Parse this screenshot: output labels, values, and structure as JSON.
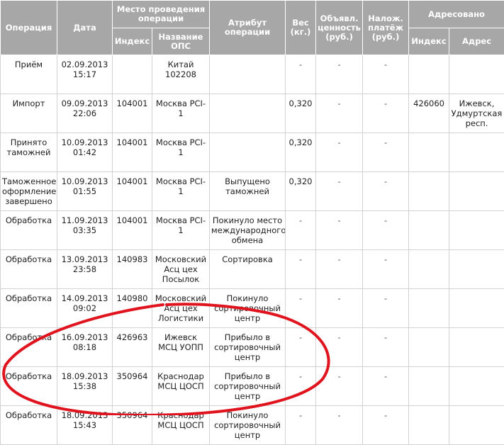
{
  "headers": {
    "operation": "Операция",
    "date": "Дата",
    "place": "Место проведения операции",
    "place_index": "Индекс",
    "place_name": "Название ОПС",
    "attribute": "Атрибут операции",
    "weight": "Вес (кг.)",
    "declared_value": "Объявл. ценность (руб.)",
    "cod": "Налож. платёж (руб.)",
    "addressed": "Адресовано",
    "addr_index": "Индекс",
    "addr_address": "Адрес"
  },
  "rows": [
    {
      "op": "Приём",
      "date": "02.09.2013",
      "time": "15:17",
      "index": "",
      "ops": "Китай 102208",
      "attr": "",
      "weight": "-",
      "value": "-",
      "cod": "-",
      "aidx": "",
      "addr": ""
    },
    {
      "op": "Импорт",
      "date": "09.09.2013",
      "time": "22:06",
      "index": "104001",
      "ops": "Москва PCI-1",
      "attr": "",
      "weight": "0,320",
      "value": "-",
      "cod": "-",
      "aidx": "426060",
      "addr": "Ижевск, Удмуртская респ."
    },
    {
      "op": "Принято таможней",
      "date": "10.09.2013",
      "time": "01:42",
      "index": "104001",
      "ops": "Москва PCI-1",
      "attr": "",
      "weight": "0,320",
      "value": "-",
      "cod": "-",
      "aidx": "",
      "addr": ""
    },
    {
      "op": "Таможенное оформление завершено",
      "date": "10.09.2013",
      "time": "01:55",
      "index": "104001",
      "ops": "Москва PCI-1",
      "attr": "Выпущено таможней",
      "weight": "0,320",
      "value": "-",
      "cod": "-",
      "aidx": "",
      "addr": ""
    },
    {
      "op": "Обработка",
      "date": "11.09.2013",
      "time": "03:35",
      "index": "104001",
      "ops": "Москва PCI-1",
      "attr": "Покинуло место международного обмена",
      "weight": "-",
      "value": "-",
      "cod": "-",
      "aidx": "",
      "addr": ""
    },
    {
      "op": "Обработка",
      "date": "13.09.2013",
      "time": "23:58",
      "index": "140983",
      "ops": "Московский Асц цех Посылок",
      "attr": "Сортировка",
      "weight": "-",
      "value": "-",
      "cod": "-",
      "aidx": "",
      "addr": ""
    },
    {
      "op": "Обработка",
      "date": "14.09.2013",
      "time": "09:02",
      "index": "140980",
      "ops": "Московский Асц цех Логистики",
      "attr": "Покинуло сортировочный центр",
      "weight": "-",
      "value": "-",
      "cod": "-",
      "aidx": "",
      "addr": ""
    },
    {
      "op": "Обработка",
      "date": "16.09.2013",
      "time": "08:18",
      "index": "426963",
      "ops": "Ижевск МСЦ УОПП",
      "attr": "Прибыло в сортировочный центр",
      "weight": "-",
      "value": "-",
      "cod": "-",
      "aidx": "",
      "addr": ""
    },
    {
      "op": "Обработка",
      "date": "18.09.2013",
      "time": "15:38",
      "index": "350964",
      "ops": "Краснодар МСЦ ЦОСП",
      "attr": "Прибыло в сортировочный центр",
      "weight": "-",
      "value": "-",
      "cod": "-",
      "aidx": "",
      "addr": ""
    },
    {
      "op": "Обработка",
      "date": "18.09.2013",
      "time": "15:43",
      "index": "350964",
      "ops": "Краснодар МСЦ ЦОСП",
      "attr": "Покинуло сортировочный центр",
      "weight": "-",
      "value": "-",
      "cod": "-",
      "aidx": "",
      "addr": ""
    }
  ],
  "annotation": {
    "color": "#e0141e"
  }
}
